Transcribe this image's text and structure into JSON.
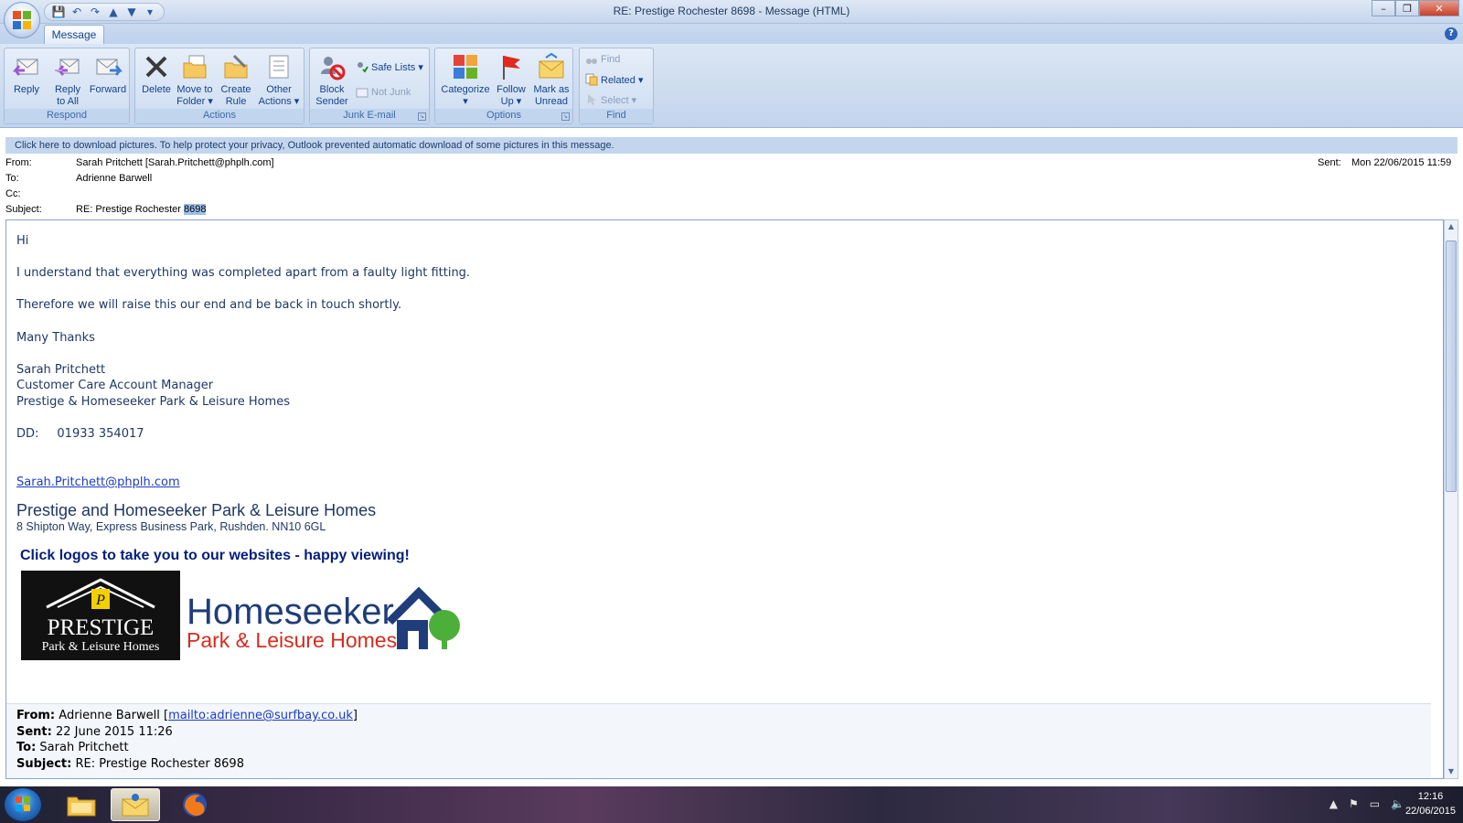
{
  "window": {
    "title": "RE: Prestige Rochester 8698 - Message (HTML)",
    "minimize": "–",
    "restore": "❐",
    "close": "✕",
    "help": "?"
  },
  "qat": {
    "save": "💾",
    "undo": "↶",
    "redo": "↷",
    "previous": "▲",
    "next": "▼",
    "customize": "▾"
  },
  "tabs": [
    "Message"
  ],
  "ribbon": {
    "respond": {
      "label": "Respond",
      "reply": "Reply",
      "reply_all": [
        "Reply",
        "to All"
      ],
      "forward": "Forward"
    },
    "actions": {
      "label": "Actions",
      "delete": "Delete",
      "move": [
        "Move to",
        "Folder ▾"
      ],
      "create_rule": [
        "Create",
        "Rule"
      ],
      "other": [
        "Other",
        "Actions ▾"
      ]
    },
    "junk": {
      "label": "Junk E-mail",
      "block": [
        "Block",
        "Sender"
      ],
      "safe_lists": "Safe Lists ▾",
      "not_junk": "Not Junk"
    },
    "options": {
      "label": "Options",
      "categorize": [
        "Categorize",
        "▾"
      ],
      "follow_up": [
        "Follow",
        "Up ▾"
      ],
      "mark_unread": [
        "Mark as",
        "Unread"
      ]
    },
    "find": {
      "label": "Find",
      "find": "Find",
      "related": "Related ▾",
      "select": "Select ▾"
    }
  },
  "infobar": "Click here to download pictures. To help protect your privacy, Outlook prevented automatic download of some pictures in this message.",
  "header": {
    "from_label": "From:",
    "from": "Sarah Pritchett [Sarah.Pritchett@phplh.com]",
    "to_label": "To:",
    "to": "Adrienne Barwell",
    "cc_label": "Cc:",
    "cc": "",
    "subject_label": "Subject:",
    "subject_prefix": "RE: Prestige Rochester ",
    "subject_highlight": "8698",
    "sent_label": "Sent:",
    "sent": "Mon 22/06/2015 11:59"
  },
  "body": {
    "greeting": "Hi",
    "line1": "I understand that everything was completed apart from a faulty light fitting.",
    "line2": "Therefore we will raise this our end and be back in touch shortly.",
    "signoff": "Many Thanks",
    "sig_name": "Sarah Pritchett",
    "sig_title": "Customer Care Account Manager",
    "sig_company": "Prestige & Homeseeker Park & Leisure Homes",
    "dd_label": "DD:",
    "dd_number": "01933 354017",
    "email": "Sarah.Pritchett@phplh.com",
    "company_name": "Prestige and Homeseeker Park & Leisure Homes",
    "company_address": "8 Shipton Way, Express Business Park, Rushden. NN10 6GL",
    "logos_tagline": "Click logos to take you to our websites - happy viewing!",
    "prestige_logo": {
      "name": "PRESTIGE",
      "sub": "Park & Leisure Homes",
      "monogram": "P"
    },
    "homeseeker_logo": {
      "name": "Homeseeker",
      "sub": "Park & Leisure Homes"
    }
  },
  "quoted": {
    "from_label": "From:",
    "from_name": "Adrienne Barwell [",
    "from_link": "mailto:adrienne@surfbay.co.uk",
    "from_close": "]",
    "sent_label": "Sent:",
    "sent": "22 June 2015 11:26",
    "to_label": "To:",
    "to": "Sarah Pritchett",
    "subject_label": "Subject:",
    "subject": "RE: Prestige Rochester 8698"
  },
  "taskbar": {
    "time": "12:16",
    "date": "22/06/2015",
    "apps": [
      "windows-explorer-icon",
      "outlook-icon",
      "firefox-icon"
    ]
  },
  "colors": {
    "accent": "#15428b",
    "body_text": "#1f3864",
    "link": "#1a3bc4",
    "logo_red": "#d52b1e",
    "logo_blue": "#1f3d7a",
    "logo_green": "#4caf3a"
  }
}
